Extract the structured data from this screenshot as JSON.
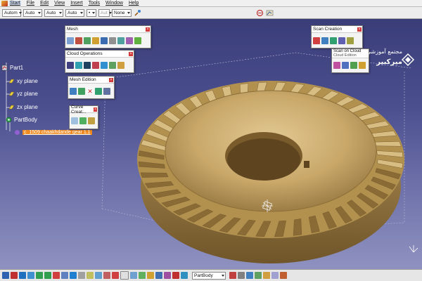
{
  "menu": {
    "items": [
      "Start",
      "File",
      "Edit",
      "View",
      "Insert",
      "Tools",
      "Window",
      "Help"
    ]
  },
  "toolbar": {
    "combos": [
      "Autom",
      "Auto",
      "Auto",
      "Auto",
      "Aut",
      "None"
    ]
  },
  "panels": {
    "mesh": {
      "title": "Mesh"
    },
    "cloud_operations": {
      "title": "Cloud Operations"
    },
    "mesh_edition": {
      "title": "Mesh Edition"
    },
    "curve_creation": {
      "title": "Curve Creat..."
    },
    "scan_creation": {
      "title": "Scan Creation"
    },
    "scan_on_cloud": {
      "title": "Scan on Cloud",
      "subtitle": "Cloud Edition"
    }
  },
  "tree": {
    "root": "Part1",
    "xy": "xy plane",
    "yz": "yz plane",
    "zx": "zx plane",
    "body": "PartBody",
    "selected": "c_1509 chaakhdande gear 1.1"
  },
  "brand": {
    "line1": "مجتمع آموزشی",
    "line2": "میرکبیر"
  },
  "statusbar": {
    "body_select": "PartBody"
  },
  "colors": {
    "gear": "#c9a86a",
    "selection": "#f08a20",
    "viewport_top": "#3a3d78"
  }
}
